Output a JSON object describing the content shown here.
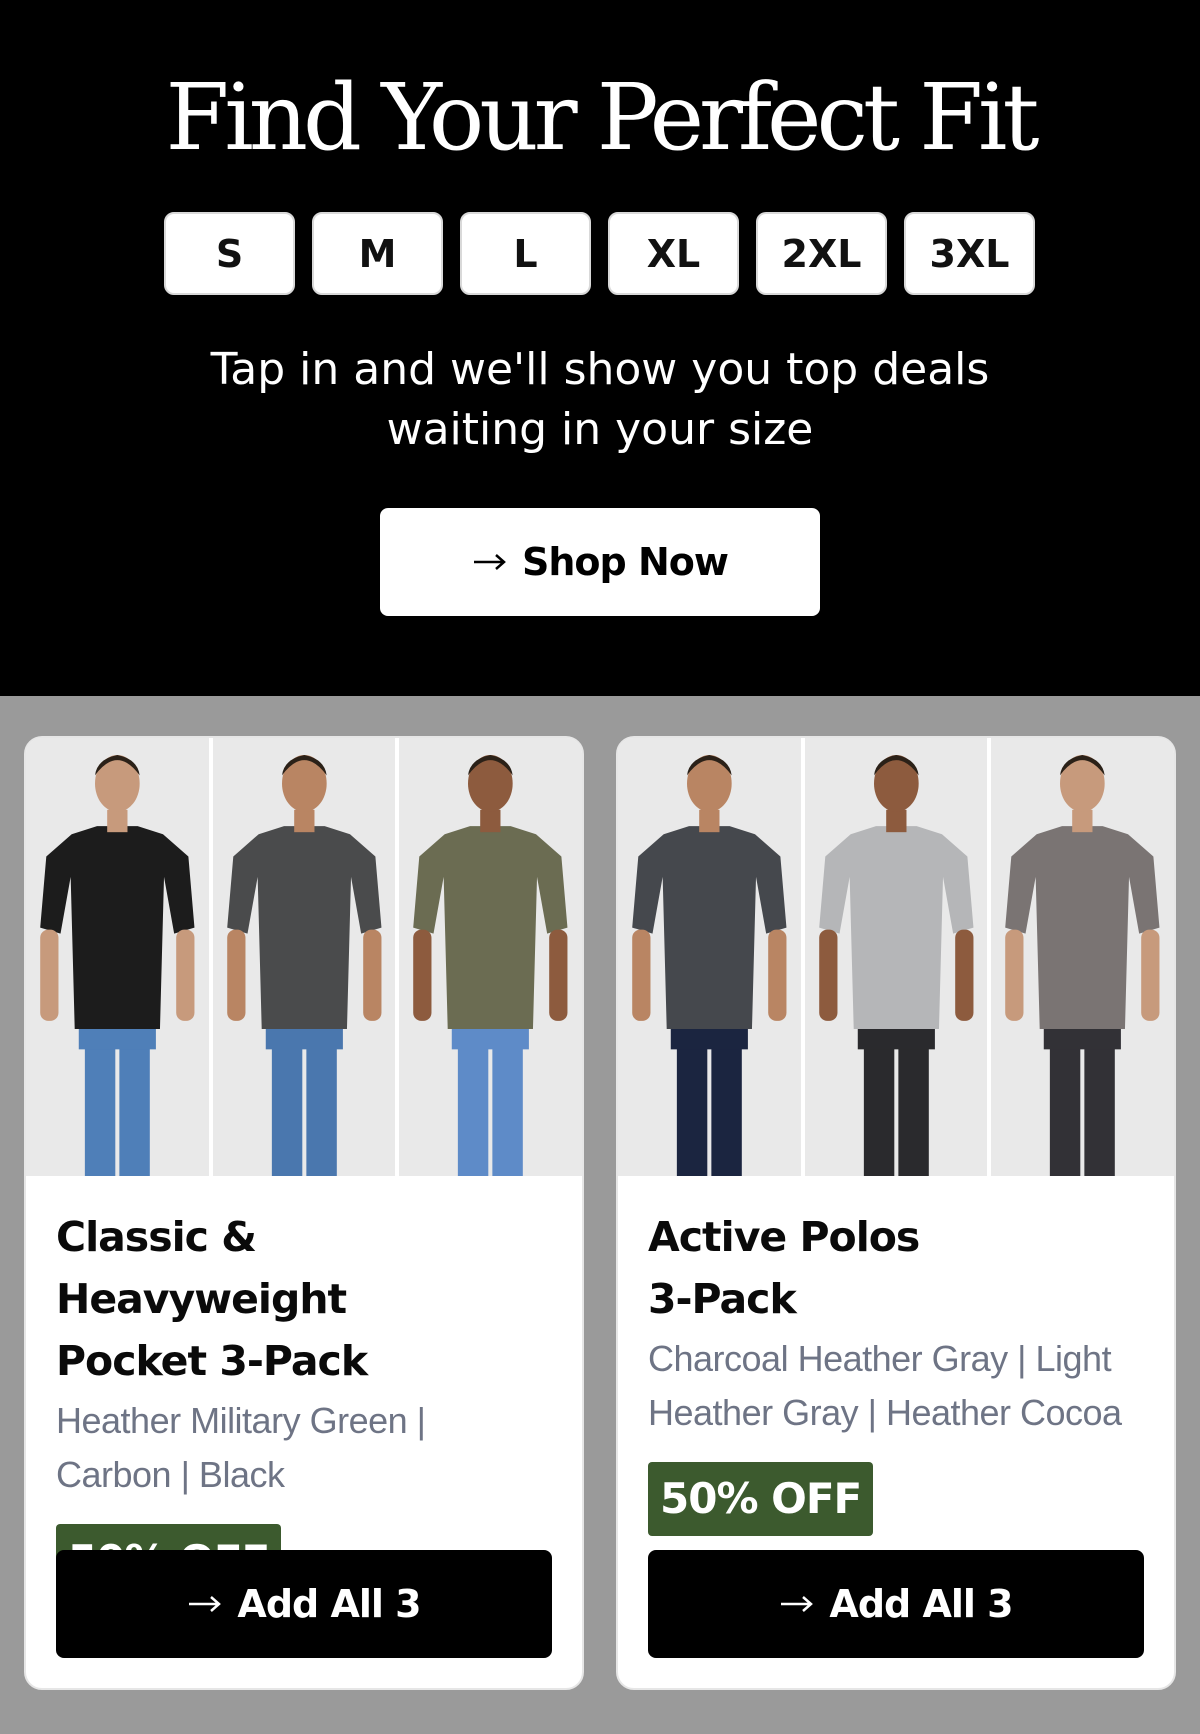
{
  "hero": {
    "title": "Find Your Perfect Fit",
    "sizes": [
      "S",
      "M",
      "L",
      "XL",
      "2XL",
      "3XL"
    ],
    "subtitle_line1": "Tap in and we'll show you top deals",
    "subtitle_line2": "waiting in your size",
    "cta_label": "Shop Now"
  },
  "products": [
    {
      "title_line1": "Classic & Heavyweight",
      "title_line2": "Pocket 3-Pack",
      "colors_line1": "Heather Military Green |",
      "colors_line2": "Carbon | Black",
      "discount": "50% OFF",
      "cta_label": "Add All 3",
      "shirt_colors": [
        "#1c1c1c",
        "#4a4b4c",
        "#6b6c52"
      ],
      "pant_colors": [
        "#4f7fb8",
        "#4a77ae",
        "#5e8bc8"
      ]
    },
    {
      "title_line1": "Active Polos",
      "title_line2": "3-Pack",
      "colors_line1": "Charcoal Heather Gray | Light",
      "colors_line2": "Heather Gray | Heather Cocoa",
      "discount": "50% OFF",
      "cta_label": "Add All 3",
      "shirt_colors": [
        "#45484d",
        "#b5b6b8",
        "#7a7473"
      ],
      "pant_colors": [
        "#1b2540",
        "#2a2a2d",
        "#323136"
      ]
    }
  ],
  "colors": {
    "discount_bg": "#3c5a2e",
    "gray_bg": "#9a9a9a"
  }
}
